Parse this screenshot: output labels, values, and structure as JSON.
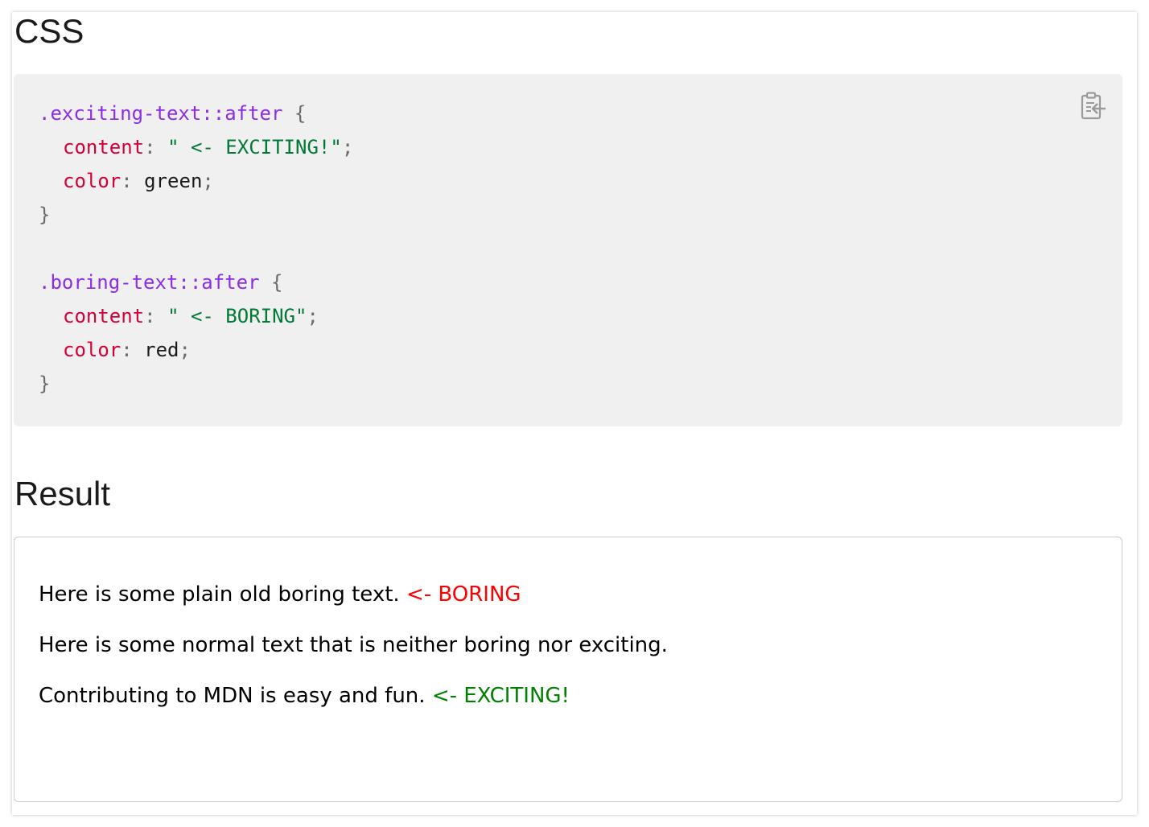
{
  "headings": {
    "css": "CSS",
    "result": "Result"
  },
  "code": {
    "rule1": {
      "selector": ".exciting-text::after",
      "open": "{",
      "prop1": "content",
      "val1": "\" <- EXCITING!\"",
      "prop2": "color",
      "val2": "green",
      "close": "}"
    },
    "rule2": {
      "selector": ".boring-text::after",
      "open": "{",
      "prop1": "content",
      "val1": "\" <- BORING\"",
      "prop2": "color",
      "val2": "red",
      "close": "}"
    },
    "copy_icon": "clipboard-copy-icon"
  },
  "result": {
    "p1_text": "Here is some plain old boring text.",
    "p1_after": "<- BORING",
    "p2_text": "Here is some normal text that is neither boring nor exciting.",
    "p3_text": "Contributing to MDN is easy and fun.",
    "p3_after": "<- EXCITING!"
  },
  "colors": {
    "selector": "#8c2ce8",
    "property": "#d30038",
    "string": "#007936",
    "boring": "#ff0000",
    "exciting": "#008000",
    "code_bg": "#f0f0f0"
  }
}
